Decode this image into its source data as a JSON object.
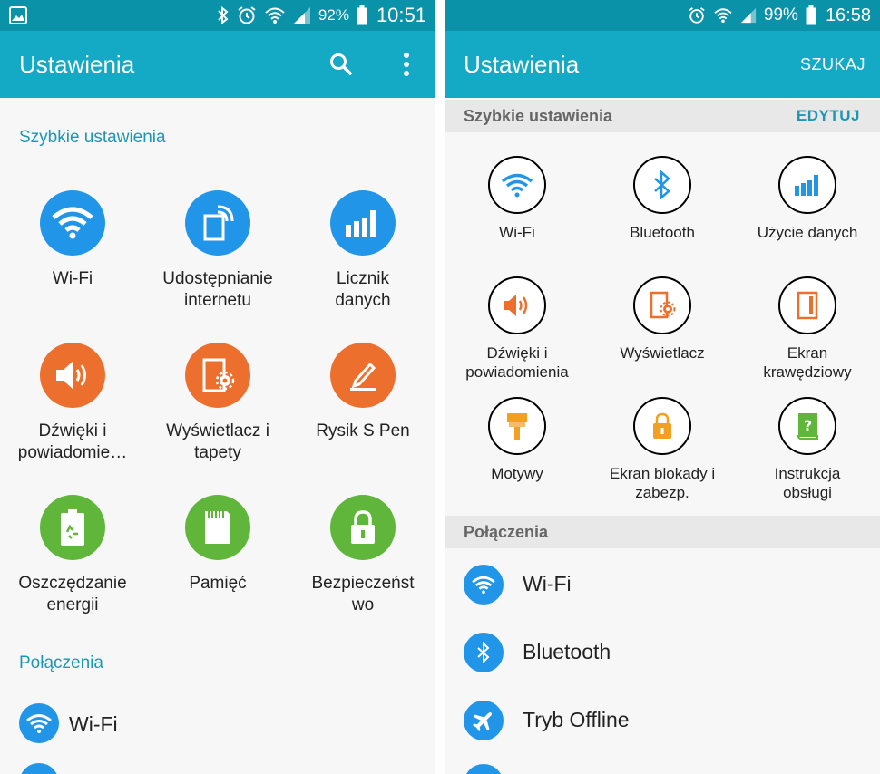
{
  "left": {
    "status": {
      "battery_pct": "92%",
      "time": "10:51"
    },
    "appbar": {
      "title": "Ustawienia"
    },
    "quick": {
      "title": "Szybkie ustawienia",
      "items": [
        {
          "line1": "Wi-Fi",
          "line2": ""
        },
        {
          "line1": "Udostępnianie",
          "line2": "internetu"
        },
        {
          "line1": "Licznik",
          "line2": "danych"
        },
        {
          "line1": "Dźwięki i",
          "line2": "powiadomie…"
        },
        {
          "line1": "Wyświetlacz i",
          "line2": "tapety"
        },
        {
          "line1": "Rysik S Pen",
          "line2": ""
        },
        {
          "line1": "Oszczędzanie",
          "line2": "energii"
        },
        {
          "line1": "Pamięć",
          "line2": ""
        },
        {
          "line1": "Bezpieczeńst",
          "line2": "wo"
        }
      ]
    },
    "connections": {
      "title": "Połączenia",
      "items": [
        {
          "label": "Wi-Fi"
        }
      ]
    }
  },
  "right": {
    "status": {
      "battery_pct": "99%",
      "time": "16:58"
    },
    "appbar": {
      "title": "Ustawienia",
      "search_label": "SZUKAJ"
    },
    "quick": {
      "title": "Szybkie ustawienia",
      "edit_label": "EDYTUJ",
      "items": [
        {
          "line1": "Wi-Fi",
          "line2": ""
        },
        {
          "line1": "Bluetooth",
          "line2": ""
        },
        {
          "line1": "Użycie danych",
          "line2": ""
        },
        {
          "line1": "Dźwięki i",
          "line2": "powiadomienia"
        },
        {
          "line1": "Wyświetlacz",
          "line2": ""
        },
        {
          "line1": "Ekran",
          "line2": "krawędziowy"
        },
        {
          "line1": "Motywy",
          "line2": ""
        },
        {
          "line1": "Ekran blokady i",
          "line2": "zabezp."
        },
        {
          "line1": "Instrukcja",
          "line2": "obsługi"
        }
      ]
    },
    "connections": {
      "title": "Połączenia",
      "items": [
        {
          "label": "Wi-Fi"
        },
        {
          "label": "Bluetooth"
        },
        {
          "label": "Tryb Offline"
        }
      ]
    }
  },
  "colors": {
    "statusbar": "#0a92a8",
    "appbar": "#14a9c5",
    "blue": "#2196e8",
    "orange": "#ec6f2d",
    "green": "#5fb63a",
    "yellow": "#f2a023",
    "section_title": "#1d98b3"
  }
}
